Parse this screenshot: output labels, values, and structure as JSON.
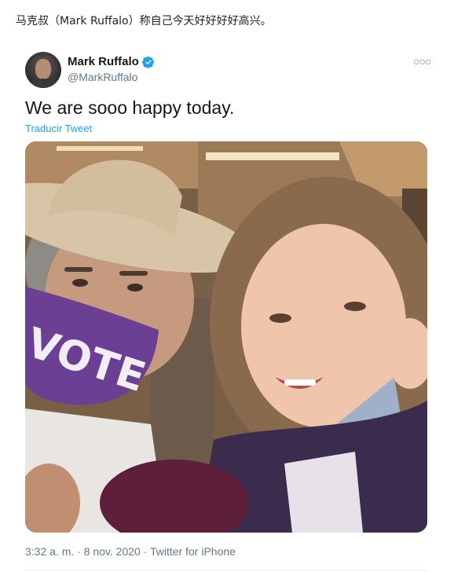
{
  "caption": "马克叔（Mark Ruffalo）称自己今天好好好好高兴。",
  "tweet": {
    "author_name": "Mark Ruffalo",
    "author_handle": "@MarkRuffalo",
    "more_icon": "more-dots-icon",
    "verified_icon": "verified-badge-icon",
    "text": "We are sooo happy today.",
    "translate_label": "Traducir Tweet",
    "mask_text": "VOTE",
    "meta": "3:32 a. m. · 8 nov. 2020 · Twitter for iPhone"
  },
  "colors": {
    "verified": "#1da1f2",
    "link": "#1da1f2",
    "secondary_text": "#657786",
    "mask": "#6b3f93"
  }
}
